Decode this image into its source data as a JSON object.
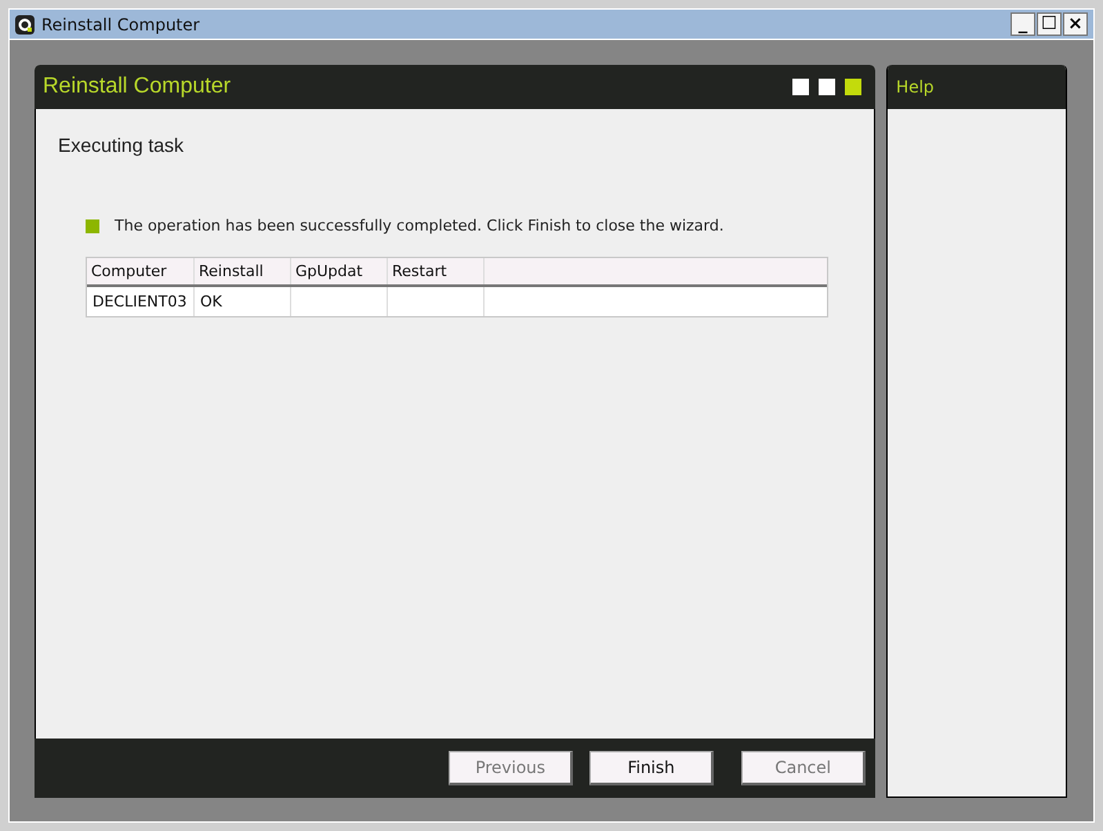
{
  "window": {
    "title": "Reinstall Computer",
    "controls": [
      "_",
      "☐",
      "×"
    ]
  },
  "wizard": {
    "title": "Reinstall Computer",
    "steps": [
      {
        "selected": false
      },
      {
        "selected": false
      },
      {
        "selected": true
      }
    ],
    "heading": "Executing task",
    "status": {
      "kind": "success",
      "text": "The operation has been successfully completed. Click Finish to close the wizard."
    }
  },
  "table": {
    "columns": [
      "Computer",
      "Reinstall",
      "GpUpdat",
      "Restart"
    ],
    "rows": [
      [
        "DECLIENT03",
        "OK",
        "",
        ""
      ]
    ]
  },
  "buttons": [
    {
      "label": "Previous",
      "disabled": true
    },
    {
      "label": "Finish",
      "disabled": false
    },
    {
      "label": "Cancel",
      "disabled": true
    }
  ],
  "help": {
    "title": "Help"
  }
}
